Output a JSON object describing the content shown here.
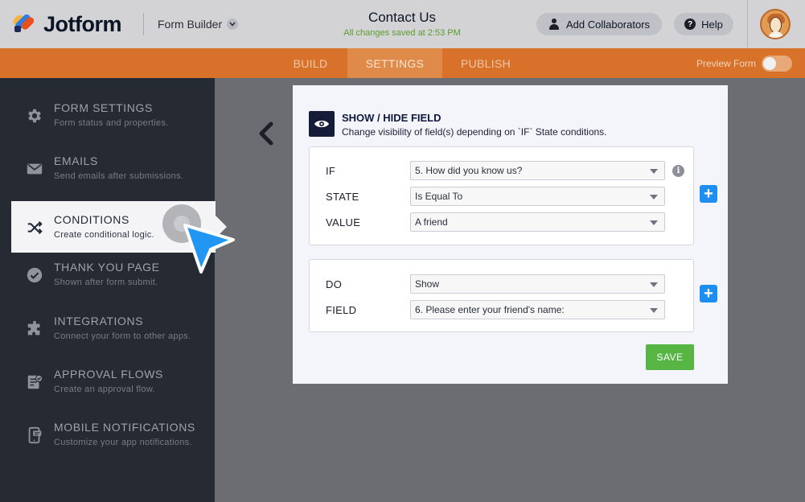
{
  "header": {
    "logo_text": "Jotform",
    "form_builder_label": "Form Builder",
    "form_title": "Contact Us",
    "saved_status": "All changes saved at 2:53 PM",
    "add_collaborators_label": "Add Collaborators",
    "help_label": "Help",
    "help_icon_glyph": "?",
    "user_icon": "user-icon"
  },
  "tabs": {
    "build": "BUILD",
    "settings": "SETTINGS",
    "publish": "PUBLISH",
    "active": "settings",
    "preview_label": "Preview Form",
    "preview_toggle_on": false
  },
  "sidebar": {
    "items": [
      {
        "label": "FORM SETTINGS",
        "sub": "Form status and properties.",
        "icon": "gear-icon"
      },
      {
        "label": "EMAILS",
        "sub": "Send emails after submissions.",
        "icon": "envelope-icon"
      },
      {
        "label": "CONDITIONS",
        "sub": "Create conditional logic.",
        "icon": "shuffle-icon",
        "active": true
      },
      {
        "label": "THANK YOU PAGE",
        "sub": "Shown after form submit.",
        "icon": "check-circle-icon"
      },
      {
        "label": "INTEGRATIONS",
        "sub": "Connect your form to other apps.",
        "icon": "puzzle-icon"
      },
      {
        "label": "APPROVAL FLOWS",
        "sub": "Create an approval flow.",
        "icon": "approval-icon"
      },
      {
        "label": "MOBILE NOTIFICATIONS",
        "sub": "Customize your app notifications.",
        "icon": "mobile-icon"
      }
    ]
  },
  "condition": {
    "icon": "eye-icon",
    "title": "SHOW / HIDE FIELD",
    "description": "Change visibility of field(s) depending on `IF` State conditions.",
    "if_label": "IF",
    "if_value": "5. How did you know us?",
    "state_label": "STATE",
    "state_value": "Is Equal To",
    "value_label": "VALUE",
    "value_value": "A friend",
    "info_glyph": "i",
    "do_label": "DO",
    "do_value": "Show",
    "field_label": "FIELD",
    "field_value": "6. Please enter your friend's name:",
    "plus_glyph": "+",
    "save_label": "SAVE"
  },
  "colors": {
    "orange_bar": "#d8712a",
    "sidebar_bg": "#262a33",
    "accent_blue": "#1e8ff0",
    "save_green": "#56b543",
    "saved_status_green": "#5a9e2c"
  }
}
